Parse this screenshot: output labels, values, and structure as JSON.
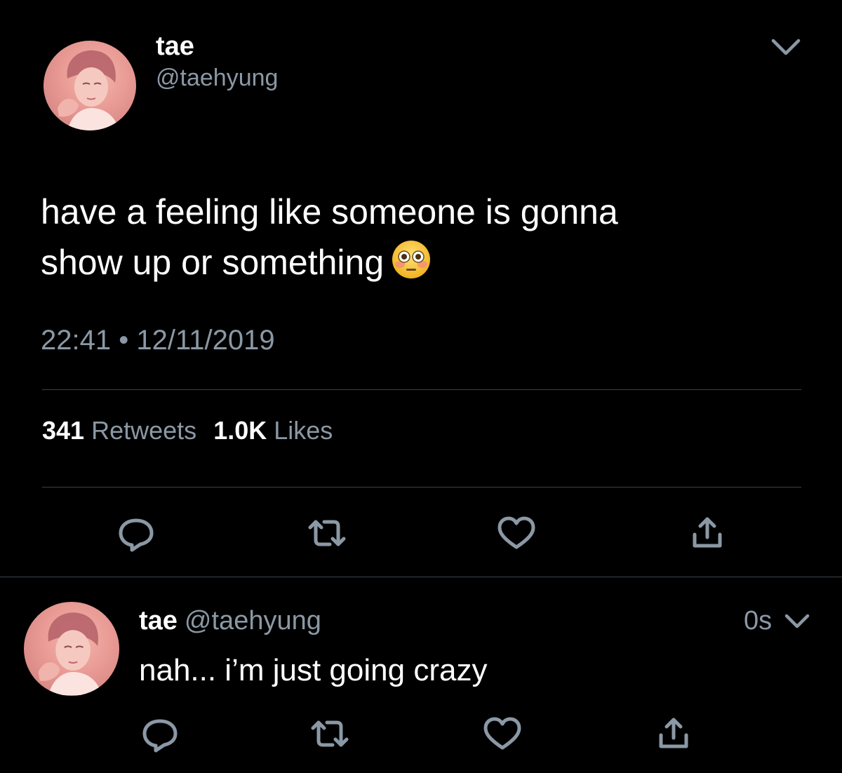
{
  "main_tweet": {
    "display_name": "tae",
    "handle": "@taehyung",
    "text_line1": "have a feeling like someone is gonna",
    "text_line2": "show up or something",
    "emoji": "flushed-face",
    "time": "22:41",
    "separator": "•",
    "date": "12/11/2019",
    "retweets_count": "341",
    "retweets_label": "Retweets",
    "likes_count": "1.0K",
    "likes_label": "Likes",
    "actions": [
      "reply-icon",
      "retweet-icon",
      "like-icon",
      "share-icon"
    ]
  },
  "reply_tweet": {
    "display_name": "tae",
    "handle": "@taehyung",
    "time_ago": "0s",
    "text": "nah... i’m just going crazy",
    "actions": [
      "reply-icon",
      "retweet-icon",
      "like-icon",
      "share-icon"
    ]
  },
  "colors": {
    "background": "#000000",
    "text": "#ffffff",
    "secondary": "#8b98a5",
    "divider": "#38444d",
    "avatar_tint": "#e99a94"
  }
}
